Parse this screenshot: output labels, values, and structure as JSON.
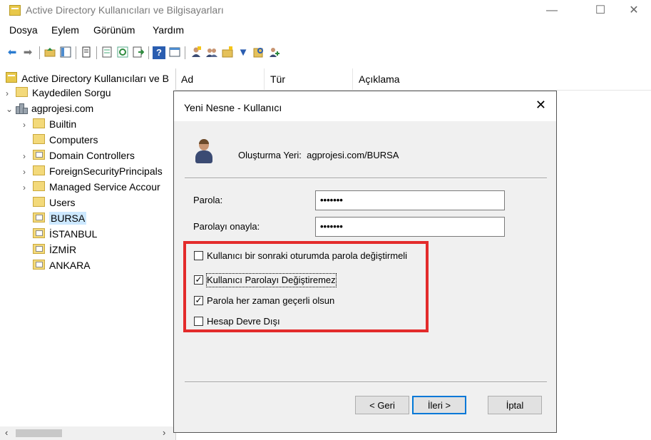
{
  "window": {
    "title": "Active Directory Kullanıcıları ve Bilgisayarları",
    "min_glyph": "—",
    "max_glyph": "☐",
    "close_glyph": "✕"
  },
  "menu": [
    "Dosya",
    "Eylem",
    "Görünüm",
    "Yardım"
  ],
  "toolbar": {
    "icons": [
      "back-icon",
      "forward-icon",
      "up-folder-icon",
      "show-tree-icon",
      "properties-icon",
      "export-list-icon",
      "refresh-icon",
      "export-icon",
      "help-icon",
      "console-tree-icon",
      "new-user-icon",
      "new-group-icon",
      "new-ou-icon",
      "filter-icon",
      "find-icon",
      "add-to-group-icon"
    ],
    "glyphs": {
      "back": "⬅",
      "forward": "➡",
      "help": "?",
      "filter": "▼"
    }
  },
  "tree": {
    "root_label": "Active Directory Kullanıcıları ve B",
    "items": [
      {
        "label": "Kaydedilen Sorgu",
        "chev": "›"
      },
      {
        "label": "agprojesi.com",
        "chev": "⌄"
      },
      {
        "label": "Builtin",
        "chev": "›"
      },
      {
        "label": "Computers",
        "chev": ""
      },
      {
        "label": "Domain Controllers",
        "chev": "›"
      },
      {
        "label": "ForeignSecurityPrincipals",
        "chev": "›"
      },
      {
        "label": "Managed Service Accour",
        "chev": "›"
      },
      {
        "label": "Users",
        "chev": ""
      },
      {
        "label": "BURSA",
        "chev": ""
      },
      {
        "label": "İSTANBUL",
        "chev": ""
      },
      {
        "label": "İZMİR",
        "chev": ""
      },
      {
        "label": "ANKARA",
        "chev": ""
      }
    ],
    "scroll_left": "‹",
    "scroll_right": "›"
  },
  "list": {
    "columns": [
      "Ad",
      "Tür",
      "Açıklama"
    ]
  },
  "dialog": {
    "title": "Yeni Nesne - Kullanıcı",
    "close_glyph": "✕",
    "location_label": "Oluşturma Yeri:",
    "location_value": "agprojesi.com/BURSA",
    "password_label": "Parola:",
    "password_value": "•••••••",
    "confirm_label": "Parolayı onayla:",
    "confirm_value": "•••••••",
    "checkboxes": [
      {
        "label": "Kullanıcı bir sonraki oturumda parola değiştirmeli",
        "checked": false
      },
      {
        "label": "Kullanıcı Parolayı Değiştiremez",
        "checked": true
      },
      {
        "label": "Parola her zaman geçerli olsun",
        "checked": true
      },
      {
        "label": "Hesap Devre Dışı",
        "checked": false
      }
    ],
    "check_glyph": "✓",
    "highlight_color": "#e32b2b",
    "buttons": {
      "back": "< Geri",
      "next": "İleri >",
      "cancel": "İptal"
    }
  }
}
